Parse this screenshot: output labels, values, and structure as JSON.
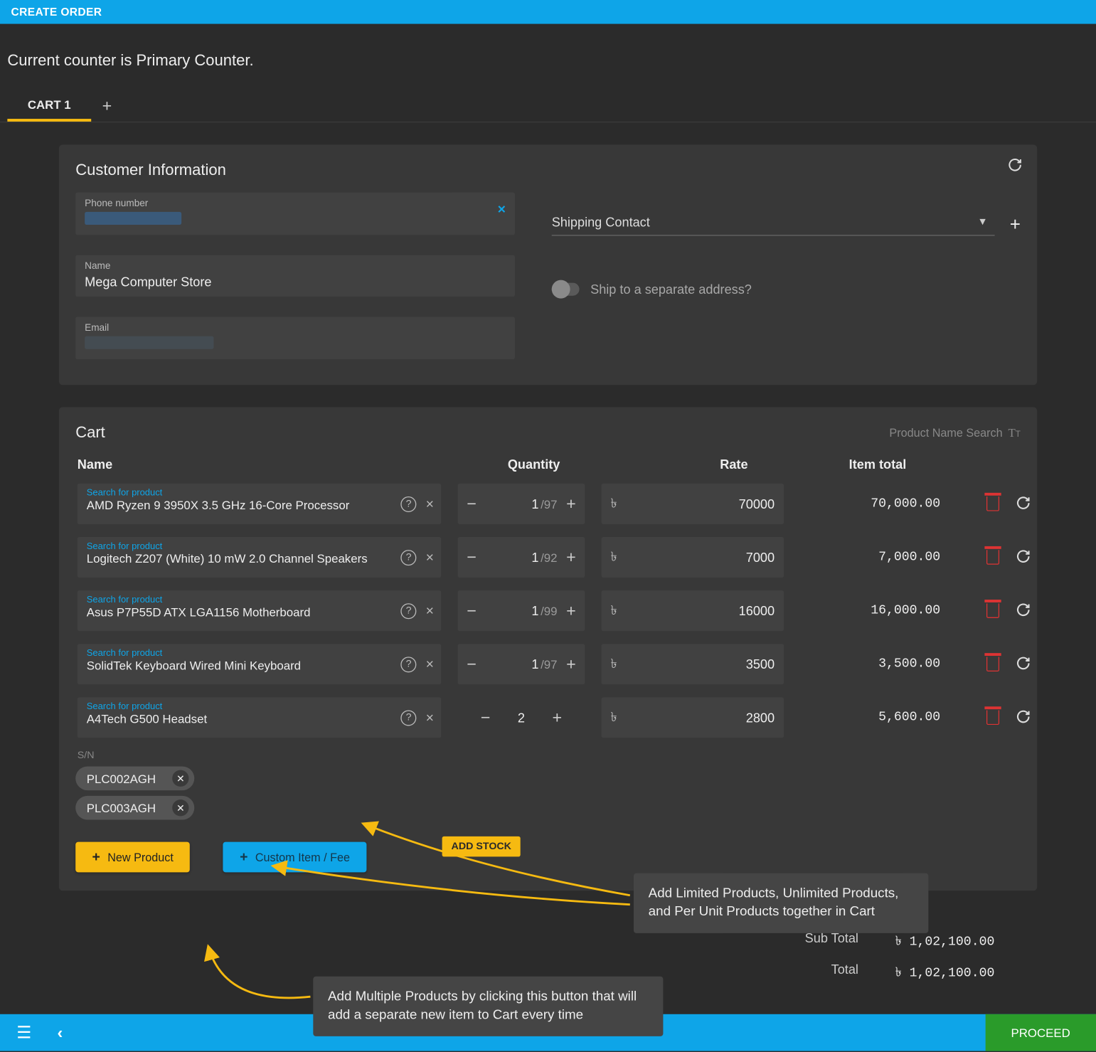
{
  "topbar": {
    "title": "CREATE ORDER"
  },
  "counter_msg": "Current counter is Primary Counter.",
  "tabs": {
    "items": [
      "CART 1"
    ],
    "add_icon": "plus-icon"
  },
  "customer": {
    "title": "Customer Information",
    "phone_label": "Phone number",
    "name_label": "Name",
    "name_value": "Mega Computer Store",
    "email_label": "Email",
    "shipping_label": "Shipping Contact",
    "ship_toggle_label": "Ship to a separate address?"
  },
  "cart": {
    "title": "Cart",
    "search_label": "Product Name Search",
    "columns": {
      "name": "Name",
      "qty": "Quantity",
      "rate": "Rate",
      "total": "Item total"
    },
    "product_field_label": "Search for product",
    "currency": "৳",
    "items": [
      {
        "name": "AMD Ryzen 9 3950X 3.5 GHz 16-Core Processor",
        "qty": "1",
        "of": "/97",
        "rate": "70000",
        "total": "70,000.00"
      },
      {
        "name": "Logitech Z207 (White) 10 mW 2.0 Channel Speakers",
        "qty": "1",
        "of": "/92",
        "rate": "7000",
        "total": "7,000.00"
      },
      {
        "name": "Asus P7P55D ATX LGA1156 Motherboard",
        "qty": "1",
        "of": "/99",
        "rate": "16000",
        "total": "16,000.00"
      },
      {
        "name": "SolidTek Keyboard Wired Mini Keyboard",
        "qty": "1",
        "of": "/97",
        "rate": "3500",
        "total": "3,500.00"
      },
      {
        "name": "A4Tech G500 Headset",
        "qty": "2",
        "of": "",
        "rate": "2800",
        "total": "5,600.00"
      }
    ],
    "sn_label": "S/N",
    "sn_chips": [
      "PLC002AGH",
      "PLC003AGH"
    ],
    "add_stock": "ADD STOCK",
    "new_product": "New Product",
    "custom_item": "Custom Item / Fee"
  },
  "callouts": {
    "c1": "Add Limited Products, Unlimited Products, and Per Unit Products together in Cart",
    "c2": "Add Multiple Products by clicking this button that will add a separate new item to Cart every time"
  },
  "totals": {
    "subtotal_label": "Sub Total",
    "subtotal": "৳ 1,02,100.00",
    "total_label": "Total",
    "total": "৳ 1,02,100.00"
  },
  "footer": {
    "proceed": "PROCEED"
  }
}
